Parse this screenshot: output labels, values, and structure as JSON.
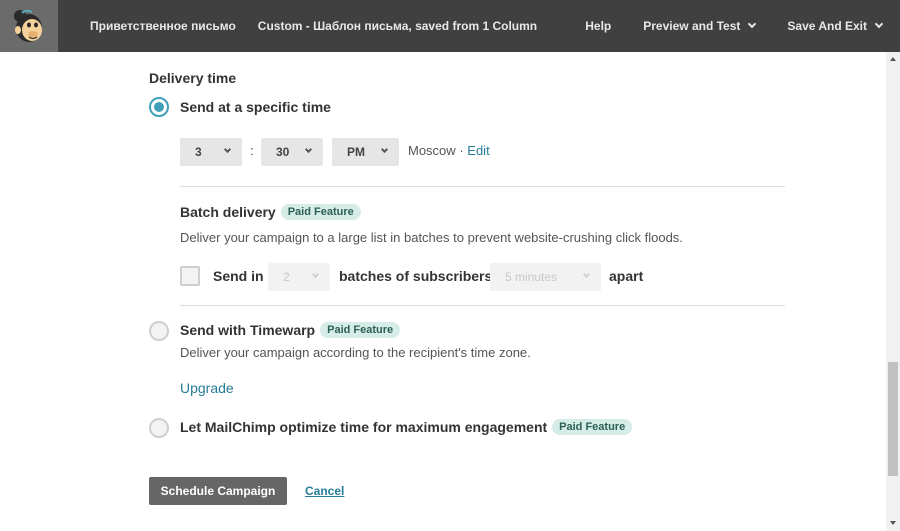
{
  "topbar": {
    "campaign_name": "Приветственное письмо",
    "template_name": "Custom - Шаблон письма, saved from 1 Column",
    "help": "Help",
    "preview": "Preview and Test",
    "save_exit": "Save And Exit"
  },
  "delivery": {
    "title": "Delivery time",
    "specific": {
      "label": "Send at a specific time",
      "hour": "3",
      "colon": ":",
      "minute": "30",
      "ampm": "PM",
      "timezone": "Moscow",
      "tz_separator": "·",
      "edit": "Edit"
    },
    "batch": {
      "title": "Batch delivery",
      "badge": "Paid Feature",
      "description": "Deliver your campaign to a large list in batches to prevent website-crushing click floods.",
      "send_in": "Send in",
      "batches_value": "2",
      "batches_of": "batches of subscribers",
      "interval_value": "5 minutes",
      "apart": "apart"
    },
    "timewarp": {
      "label": "Send with Timewarp",
      "badge": "Paid Feature",
      "description": "Deliver your campaign according to the recipient's time zone.",
      "upgrade": "Upgrade"
    },
    "optimize": {
      "label": "Let MailChimp optimize time for maximum engagement",
      "badge": "Paid Feature"
    }
  },
  "actions": {
    "schedule": "Schedule Campaign",
    "cancel": "Cancel"
  },
  "colors": {
    "accent": "#3fa0b8",
    "link": "#267c96",
    "topbar": "#404040",
    "badge_bg": "#d6ece7"
  }
}
